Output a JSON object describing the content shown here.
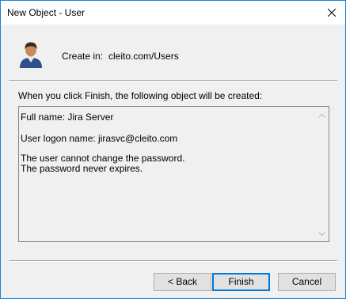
{
  "window": {
    "title": "New Object - User"
  },
  "header": {
    "create_in_label": "Create in:",
    "create_in_path": "cleito.com/Users"
  },
  "main": {
    "intro": "When you click Finish, the following object will be created:",
    "summary_lines": [
      "Full name: Jira Server",
      "",
      "User logon name: jirasvc@cleito.com",
      "",
      "The user cannot change the password.",
      "The password never expires."
    ]
  },
  "buttons": {
    "back": "< Back",
    "finish": "Finish",
    "cancel": "Cancel"
  },
  "icons": {
    "close": "close-icon",
    "avatar": "user-icon",
    "scroll_up": "scroll-up-arrow-icon",
    "scroll_down": "scroll-down-arrow-icon"
  },
  "colors": {
    "window_border": "#1883d7",
    "default_button_border": "#0078d7",
    "dialog_bg": "#f0f0f0"
  }
}
